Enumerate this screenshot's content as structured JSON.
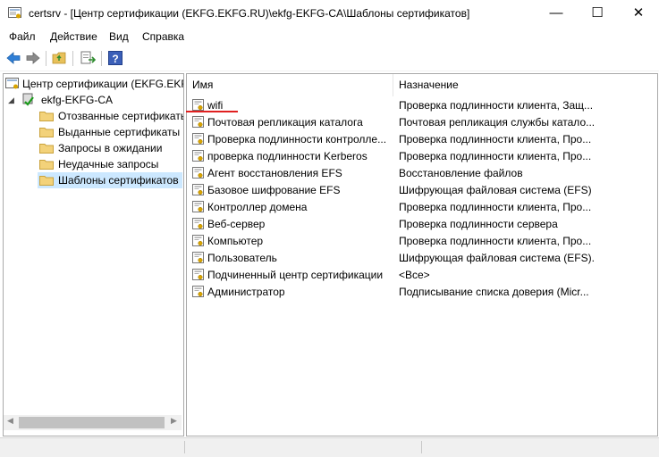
{
  "window": {
    "title": "certsrv - [Центр сертификации (EKFG.EKFG.RU)\\ekfg-EKFG-CA\\Шаблоны сертификатов]",
    "minimize_symbol": "—",
    "maximize_symbol": "☐",
    "close_symbol": "✕"
  },
  "menu": [
    "Файл",
    "Действие",
    "Вид",
    "Справка"
  ],
  "toolbar": {
    "buttons": [
      "back-icon",
      "forward-icon",
      "up-folder-icon",
      "export-list-icon",
      "help-icon"
    ]
  },
  "tree": {
    "root": "Центр сертификации (EKFG.EKFG.RU)",
    "ca_node": "ekfg-EKFG-CA",
    "folders": [
      "Отозванные сертификаты",
      "Выданные сертификаты",
      "Запросы в ожидании",
      "Неудачные запросы",
      "Шаблоны сертификатов"
    ],
    "selected_index": 4
  },
  "list": {
    "columns": [
      "Имя",
      "Назначение"
    ],
    "rows": [
      {
        "name": "wifi",
        "purpose": "Проверка подлинности клиента, Защ..."
      },
      {
        "name": "Почтовая репликация каталога",
        "purpose": "Почтовая репликация службы катало..."
      },
      {
        "name": "Проверка подлинности контролле...",
        "purpose": "Проверка подлинности клиента, Про..."
      },
      {
        "name": "проверка подлинности Kerberos",
        "purpose": "Проверка подлинности клиента, Про..."
      },
      {
        "name": "Агент восстановления EFS",
        "purpose": "Восстановление файлов"
      },
      {
        "name": "Базовое шифрование EFS",
        "purpose": "Шифрующая файловая система (EFS)"
      },
      {
        "name": "Контроллер домена",
        "purpose": "Проверка подлинности клиента, Про..."
      },
      {
        "name": "Веб-сервер",
        "purpose": "Проверка подлинности сервера"
      },
      {
        "name": "Компьютер",
        "purpose": "Проверка подлинности клиента, Про..."
      },
      {
        "name": "Пользователь",
        "purpose": "Шифрующая файловая система (EFS)..."
      },
      {
        "name": "Подчиненный центр сертификации",
        "purpose": "<Все>"
      },
      {
        "name": "Администратор",
        "purpose": "Подписывание списка доверия (Micr..."
      }
    ]
  },
  "colors": {
    "selection": "#cce8ff",
    "annotation_underline": "#e02020",
    "pane_border": "#a9a9a9"
  }
}
